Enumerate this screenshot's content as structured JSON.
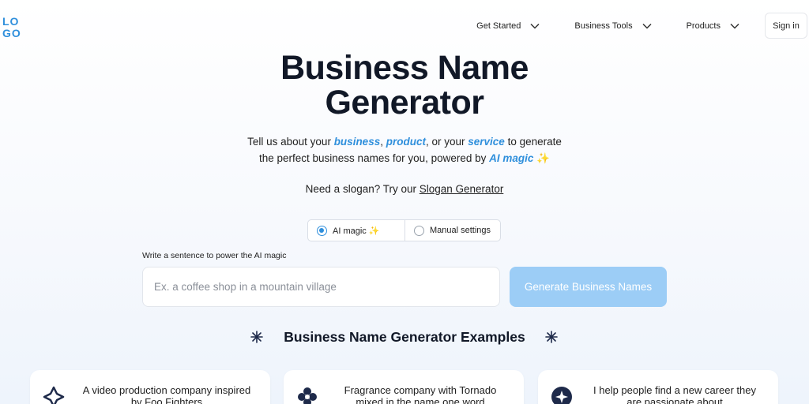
{
  "header": {
    "logo_text": "LOGO",
    "nav": [
      {
        "label": "Get Started"
      },
      {
        "label": "Business Tools"
      },
      {
        "label": "Products"
      }
    ],
    "signin_label": "Sign in"
  },
  "hero": {
    "title_line1": "Business Name",
    "title_line2": "Generator",
    "sub": {
      "pre": "Tell us about your ",
      "business": "business",
      "comma": ", ",
      "product": "product",
      "mid": ", or your ",
      "service": "service",
      "post": " to generate",
      "line2": "the perfect business names for you, powered by ",
      "ai_magic": "AI magic",
      "sparkle": "✨"
    },
    "slogan_pre": "Need a slogan? Try our ",
    "slogan_link": "Slogan Generator"
  },
  "mode": {
    "options": [
      {
        "label": "AI magic ✨",
        "selected": true
      },
      {
        "label": "Manual settings",
        "selected": false
      }
    ]
  },
  "form": {
    "label": "Write a sentence to power the AI magic",
    "placeholder": "Ex. a coffee shop in a mountain village",
    "value": "",
    "button_label": "Generate Business Names"
  },
  "examples": {
    "title": "Business Name Generator Examples",
    "cards": [
      {
        "text": "A video production company inspired by Foo Fighters",
        "icon": "diamond-star-icon"
      },
      {
        "text": "Fragrance company with Tornado mixed in the name one word",
        "icon": "flower-icon"
      },
      {
        "text": "I help people find a new career they are passionate about",
        "icon": "star-badge-icon"
      }
    ]
  },
  "colors": {
    "accent": "#2f8fdc",
    "button_bg": "#9ccdf6",
    "logo": "#2f8fdc",
    "icon_dark": "#1e2a4a"
  }
}
